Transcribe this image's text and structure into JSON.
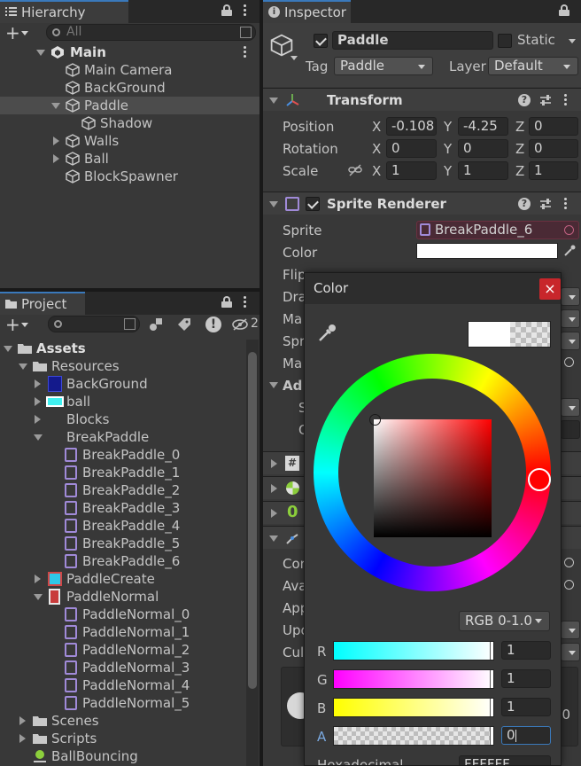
{
  "hierarchy": {
    "tab": "Hierarchy",
    "search_placeholder": "All",
    "items": [
      {
        "label": "Main"
      },
      {
        "label": "Main Camera"
      },
      {
        "label": "BackGround"
      },
      {
        "label": "Paddle"
      },
      {
        "label": "Shadow"
      },
      {
        "label": "Walls"
      },
      {
        "label": "Ball"
      },
      {
        "label": "BlockSpawner"
      }
    ]
  },
  "project": {
    "tab": "Project",
    "hidden_count": "2",
    "items": [
      {
        "label": "Assets"
      },
      {
        "label": "Resources"
      },
      {
        "label": "BackGround"
      },
      {
        "label": "ball"
      },
      {
        "label": "Blocks"
      },
      {
        "label": "BreakPaddle"
      },
      {
        "label": "BreakPaddle_0"
      },
      {
        "label": "BreakPaddle_1"
      },
      {
        "label": "BreakPaddle_2"
      },
      {
        "label": "BreakPaddle_3"
      },
      {
        "label": "BreakPaddle_4"
      },
      {
        "label": "BreakPaddle_5"
      },
      {
        "label": "BreakPaddle_6"
      },
      {
        "label": "PaddleCreate"
      },
      {
        "label": "PaddleNormal"
      },
      {
        "label": "PaddleNormal_0"
      },
      {
        "label": "PaddleNormal_1"
      },
      {
        "label": "PaddleNormal_2"
      },
      {
        "label": "PaddleNormal_3"
      },
      {
        "label": "PaddleNormal_4"
      },
      {
        "label": "PaddleNormal_5"
      },
      {
        "label": "Scenes"
      },
      {
        "label": "Scripts"
      },
      {
        "label": "BallBouncing"
      }
    ]
  },
  "inspector": {
    "tab": "Inspector",
    "object_name": "Paddle",
    "static_label": "Static",
    "tag_label": "Tag",
    "tag_value": "Paddle",
    "layer_label": "Layer",
    "layer_value": "Default",
    "transform": {
      "title": "Transform",
      "position_label": "Position",
      "rotation_label": "Rotation",
      "scale_label": "Scale",
      "x": "X",
      "y": "Y",
      "z": "Z",
      "position": [
        "-0.108",
        "-4.25",
        "0"
      ],
      "rotation": [
        "0",
        "0",
        "0"
      ],
      "scale": [
        "1",
        "1",
        "1"
      ]
    },
    "sprite_renderer": {
      "title": "Sprite Renderer",
      "sprite_label": "Sprite",
      "sprite_value": "BreakPaddle_6",
      "color_label": "Color",
      "color_value": "#ffffff",
      "partial_labels": [
        "Flip",
        "Dra",
        "Ma",
        "Spr",
        "Ma",
        "Ad",
        "S",
        "C"
      ]
    },
    "more_partial_labels": [
      "Cor",
      "Ava",
      "App",
      "Upd",
      "Cul"
    ],
    "digit_badge": "0",
    "right_zero": "0"
  },
  "color_picker": {
    "title": "Color",
    "close_glyph": "×",
    "mode": "RGB 0-1.0",
    "channels": [
      {
        "label": "R",
        "value": "1"
      },
      {
        "label": "G",
        "value": "1"
      },
      {
        "label": "B",
        "value": "1"
      },
      {
        "label": "A",
        "value": "0"
      }
    ],
    "hex_label": "Hexadecimal",
    "hex_value": "FFFFFF",
    "colors": {
      "accent": "#3a79bb",
      "selected_hue": "#ff0000"
    }
  }
}
